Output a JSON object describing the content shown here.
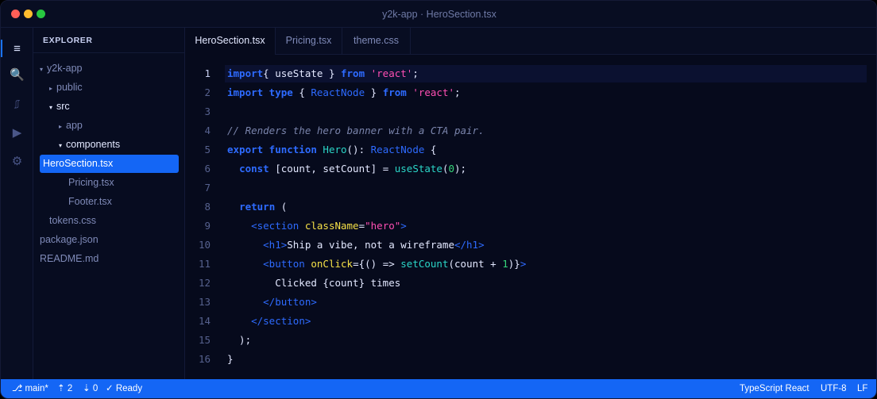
{
  "window": {
    "title": "y2k-app · HeroSection.tsx"
  },
  "activity_bar": [
    {
      "name": "explorer-icon",
      "glyph": "≡",
      "active": true
    },
    {
      "name": "search-icon",
      "glyph": "🔍",
      "active": false
    },
    {
      "name": "source-control-icon",
      "glyph": "⎎",
      "active": false
    },
    {
      "name": "run-icon",
      "glyph": "▶",
      "active": false
    },
    {
      "name": "settings-icon",
      "glyph": "⚙",
      "active": false
    }
  ],
  "sidebar": {
    "title": "EXPLORER",
    "items": [
      {
        "label": "y2k-app",
        "caret": "▾",
        "open": false
      },
      {
        "label": "public",
        "caret": "▸",
        "open": false
      },
      {
        "label": "src",
        "caret": "▾",
        "open": true
      },
      {
        "label": "app",
        "caret": "▸",
        "open": false
      },
      {
        "label": "components",
        "caret": "▾",
        "open": true
      },
      {
        "label": "HeroSection.tsx",
        "caret": "",
        "selected": true
      },
      {
        "label": "Pricing.tsx",
        "caret": ""
      },
      {
        "label": "Footer.tsx",
        "caret": ""
      },
      {
        "label": "tokens.css",
        "caret": ""
      },
      {
        "label": "package.json",
        "caret": ""
      },
      {
        "label": "README.md",
        "caret": ""
      }
    ]
  },
  "tabs": [
    {
      "label": "HeroSection.tsx",
      "active": true
    },
    {
      "label": "Pricing.tsx",
      "active": false
    },
    {
      "label": "theme.css",
      "active": false
    }
  ],
  "editor": {
    "current_line": 1,
    "lines": [
      [
        [
          "kw",
          "import"
        ],
        [
          "",
          "{ useState } "
        ],
        [
          "kw",
          "from"
        ],
        [
          "str",
          " 'react'"
        ],
        [
          "",
          ";"
        ]
      ],
      [
        [
          "kw",
          "import"
        ],
        [
          "kw",
          " type"
        ],
        [
          "",
          " { "
        ],
        [
          "typ",
          "ReactNode"
        ],
        [
          "",
          " } "
        ],
        [
          "kw",
          "from"
        ],
        [
          "str",
          " 'react'"
        ],
        [
          "",
          ";"
        ]
      ],
      [],
      [
        [
          "cm",
          "// Renders the hero banner with a CTA pair."
        ]
      ],
      [
        [
          "kw",
          "export"
        ],
        [
          "kw",
          " function"
        ],
        [
          "fn",
          " Hero"
        ],
        [
          "",
          "(): "
        ],
        [
          "typ",
          "ReactNode"
        ],
        [
          "",
          " {"
        ]
      ],
      [
        [
          "",
          "  "
        ],
        [
          "kw",
          "const"
        ],
        [
          "",
          " [count, setCount] = "
        ],
        [
          "fn",
          "useState"
        ],
        [
          "",
          "("
        ],
        [
          "num",
          "0"
        ],
        [
          "",
          ");"
        ]
      ],
      [],
      [
        [
          "",
          "  "
        ],
        [
          "kw",
          "return"
        ],
        [
          "",
          " ("
        ]
      ],
      [
        [
          "",
          "    "
        ],
        [
          "tag",
          "<section"
        ],
        [
          "attr",
          " className"
        ],
        [
          "",
          "="
        ],
        [
          "str",
          "\"hero\""
        ],
        [
          "tag",
          ">"
        ]
      ],
      [
        [
          "",
          "      "
        ],
        [
          "tag",
          "<h1>"
        ],
        [
          "",
          "Ship a vibe, not a wireframe"
        ],
        [
          "tag",
          "</h1>"
        ]
      ],
      [
        [
          "",
          "      "
        ],
        [
          "tag",
          "<button"
        ],
        [
          "attr",
          " onClick"
        ],
        [
          "",
          "={() => "
        ],
        [
          "fn",
          "setCount"
        ],
        [
          "",
          "(count + "
        ],
        [
          "num",
          "1"
        ],
        [
          "",
          ")}"
        ],
        [
          "tag",
          ">"
        ]
      ],
      [
        [
          "",
          "        Clicked {count} times"
        ]
      ],
      [
        [
          "",
          "      "
        ],
        [
          "tag",
          "</button>"
        ]
      ],
      [
        [
          "",
          "    "
        ],
        [
          "tag",
          "</section>"
        ]
      ],
      [
        [
          "",
          "  );"
        ]
      ],
      [
        [
          "",
          "}"
        ]
      ]
    ]
  },
  "status_bar": {
    "branch": "⎇ main*",
    "ahead": "⇡ 2",
    "behind": "⇣ 0",
    "state": "✓ Ready",
    "language": "TypeScript React",
    "encoding": "UTF-8",
    "eol": "LF"
  }
}
